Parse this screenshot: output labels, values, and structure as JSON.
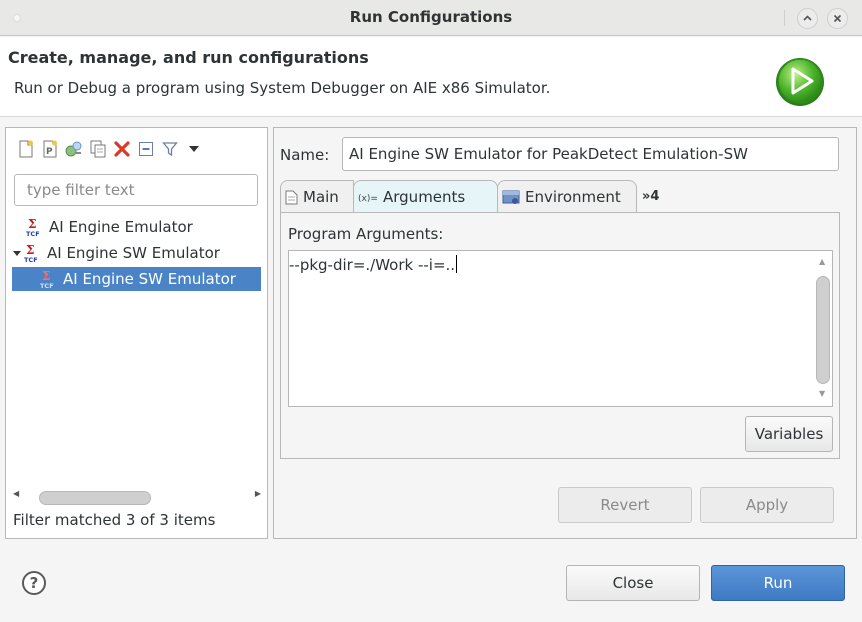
{
  "window": {
    "title": "Run Configurations"
  },
  "banner": {
    "heading": "Create, manage, and run configurations",
    "description": "Run or Debug a program using System Debugger on AIE x86 Simulator."
  },
  "left": {
    "filter_placeholder": "type filter text",
    "tree": [
      {
        "label": "AI Engine Emulator"
      },
      {
        "label": "AI Engine SW Emulator"
      },
      {
        "label": "AI Engine SW Emulator"
      }
    ],
    "status": "Filter matched 3 of 3 items"
  },
  "right": {
    "name_label": "Name:",
    "name_value": "AI Engine SW Emulator for PeakDetect Emulation-SW",
    "tabs": [
      {
        "label": "Main"
      },
      {
        "label": "Arguments"
      },
      {
        "label": "Environment"
      },
      {
        "label": "»4"
      }
    ],
    "program_arguments_label": "Program Arguments:",
    "program_arguments_value": "--pkg-dir=./Work --i=..",
    "variables_label": "Variables",
    "revert_label": "Revert",
    "apply_label": "Apply"
  },
  "footer": {
    "close_label": "Close",
    "run_label": "Run"
  },
  "colors": {
    "selection": "#4a84c7",
    "run_button": "#4a88d0",
    "active_tab": "#e6f5f7"
  }
}
